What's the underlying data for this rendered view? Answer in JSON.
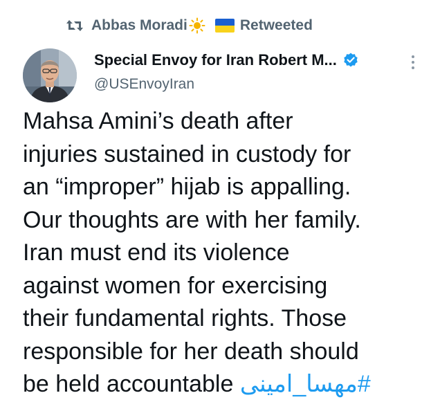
{
  "retweet": {
    "user": "Abbas Moradi",
    "label": "Retweeted",
    "icons": [
      "retweet-icon",
      "sun-icon",
      "ukraine-flag-icon"
    ]
  },
  "author": {
    "display_name": "Special Envoy for Iran Robert M...",
    "handle": "@USEnvoyIran",
    "verified": true
  },
  "tweet": {
    "lines": [
      "Mahsa Amini’s death after",
      "injuries sustained in custody for",
      "an “improper” hijab is appalling.",
      "Our thoughts are with her family.",
      "Iran must end its violence",
      "against women for exercising",
      "their fundamental rights. Those",
      "responsible for her death should",
      "be held accountable "
    ],
    "hashtag": "#مهسا_امینی"
  },
  "colors": {
    "text": "#0f1419",
    "secondary": "#536471",
    "link": "#1d9bf0",
    "verified": "#1d9bf0"
  }
}
